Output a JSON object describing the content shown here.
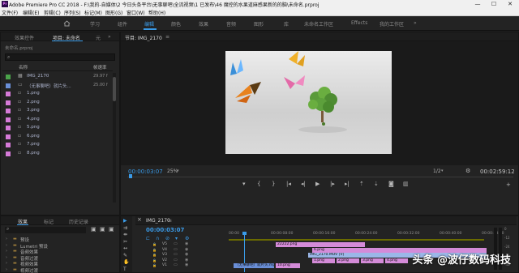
{
  "window": {
    "title": "Adobe Premiere Pro CC 2018 - F:\\我的-自媒体\\2 今日头条平台\\无事聊吧\\全流视频\\1 已发布\\46 魔控的水果道麻感果新的的脑\\未命名.prproj",
    "app_icon": "Pr",
    "minimize": "—",
    "maximize": "☐",
    "close": "✕"
  },
  "menu": [
    "文件(F)",
    "编辑(E)",
    "剪辑(C)",
    "序列(S)",
    "标记(M)",
    "图形(G)",
    "窗口(W)",
    "帮助(H)"
  ],
  "workspaces": {
    "home_icon": "home-icon",
    "items": [
      "学习",
      "组件",
      "编辑",
      "颜色",
      "效果",
      "音频",
      "图形",
      "库",
      "未命名工作区",
      "Effects",
      "我的工作区"
    ],
    "active": "编辑",
    "more": "»"
  },
  "project_panel": {
    "tabs": [
      "效果控件",
      "项目: 未命名",
      "元"
    ],
    "project_file": "未命名.prproj",
    "search_placeholder": "",
    "columns": [
      "名称",
      "帧速率"
    ],
    "items": [
      {
        "name": "IMG_2170",
        "fps": "29.97 f",
        "color": "#4aa34a",
        "kind": "sequence"
      },
      {
        "name": "（无事聊吧）就片头...",
        "fps": "25.00 f",
        "color": "#6a8fd8",
        "kind": "video"
      },
      {
        "name": "1.png",
        "fps": "",
        "color": "#d57ad8",
        "kind": "image"
      },
      {
        "name": "2.png",
        "fps": "",
        "color": "#d57ad8",
        "kind": "image"
      },
      {
        "name": "3.png",
        "fps": "",
        "color": "#d57ad8",
        "kind": "image"
      },
      {
        "name": "4.png",
        "fps": "",
        "color": "#d57ad8",
        "kind": "image"
      },
      {
        "name": "5.png",
        "fps": "",
        "color": "#d57ad8",
        "kind": "image"
      },
      {
        "name": "6.png",
        "fps": "",
        "color": "#d57ad8",
        "kind": "image"
      },
      {
        "name": "7.png",
        "fps": "",
        "color": "#d57ad8",
        "kind": "image"
      },
      {
        "name": "8.png",
        "fps": "",
        "color": "#d57ad8",
        "kind": "image"
      }
    ]
  },
  "effects_panel": {
    "tabs": [
      "效果",
      "标记",
      "历史记录"
    ],
    "items": [
      "预设",
      "Lumetri 预设",
      "音频效果",
      "音频过渡",
      "视频效果",
      "视频过渡"
    ]
  },
  "program_monitor": {
    "title": "节目: IMG_2170",
    "timecode": "00:00:03:07",
    "zoom": "25%",
    "resolution": "1/2",
    "duration": "00:02:59:12",
    "transport": [
      "marker-icon",
      "in-icon",
      "out-icon",
      "go-in-icon",
      "step-back-icon",
      "play-icon",
      "step-fwd-icon",
      "go-out-icon",
      "lift-icon",
      "extract-icon",
      "camera-icon",
      "compare-icon",
      "add-icon"
    ]
  },
  "timeline": {
    "tab": "IMG_2170",
    "timecode": "00:00:03:07",
    "ruler": [
      "00:00",
      "00:00:08:00",
      "00:00:16:00",
      "00:00:24:00",
      "00:00:32:00",
      "00:00:40:00",
      "00:00:48:00"
    ],
    "tracks": [
      "V5",
      "V4",
      "V3",
      "V2",
      "V1"
    ],
    "clips": [
      {
        "track": 0,
        "label": "22222.png",
        "color": "#d48bd8"
      },
      {
        "track": 1,
        "label": "6.png",
        "color": "#d48bd8"
      },
      {
        "track": 2,
        "label": "IMG_2170.MOV [V]",
        "color": "#9bb7e8"
      },
      {
        "track": 3,
        "label": "1.png",
        "color": "#d48bd8"
      },
      {
        "track": 3,
        "label": "2.png",
        "color": "#d48bd8"
      },
      {
        "track": 3,
        "label": "3.png",
        "color": "#d48bd8"
      },
      {
        "track": 3,
        "label": "4.png",
        "color": "#d48bd8"
      },
      {
        "track": 4,
        "label": "（无事聊吧）就片头.mp4",
        "color": "#6a8fd8"
      },
      {
        "track": 4,
        "label": "10.png",
        "color": "#d48bd8"
      }
    ],
    "meter_ticks": [
      "0",
      "-12",
      "-24",
      "-36",
      "-48"
    ]
  },
  "watermark": "头条 @波仔数码科技"
}
